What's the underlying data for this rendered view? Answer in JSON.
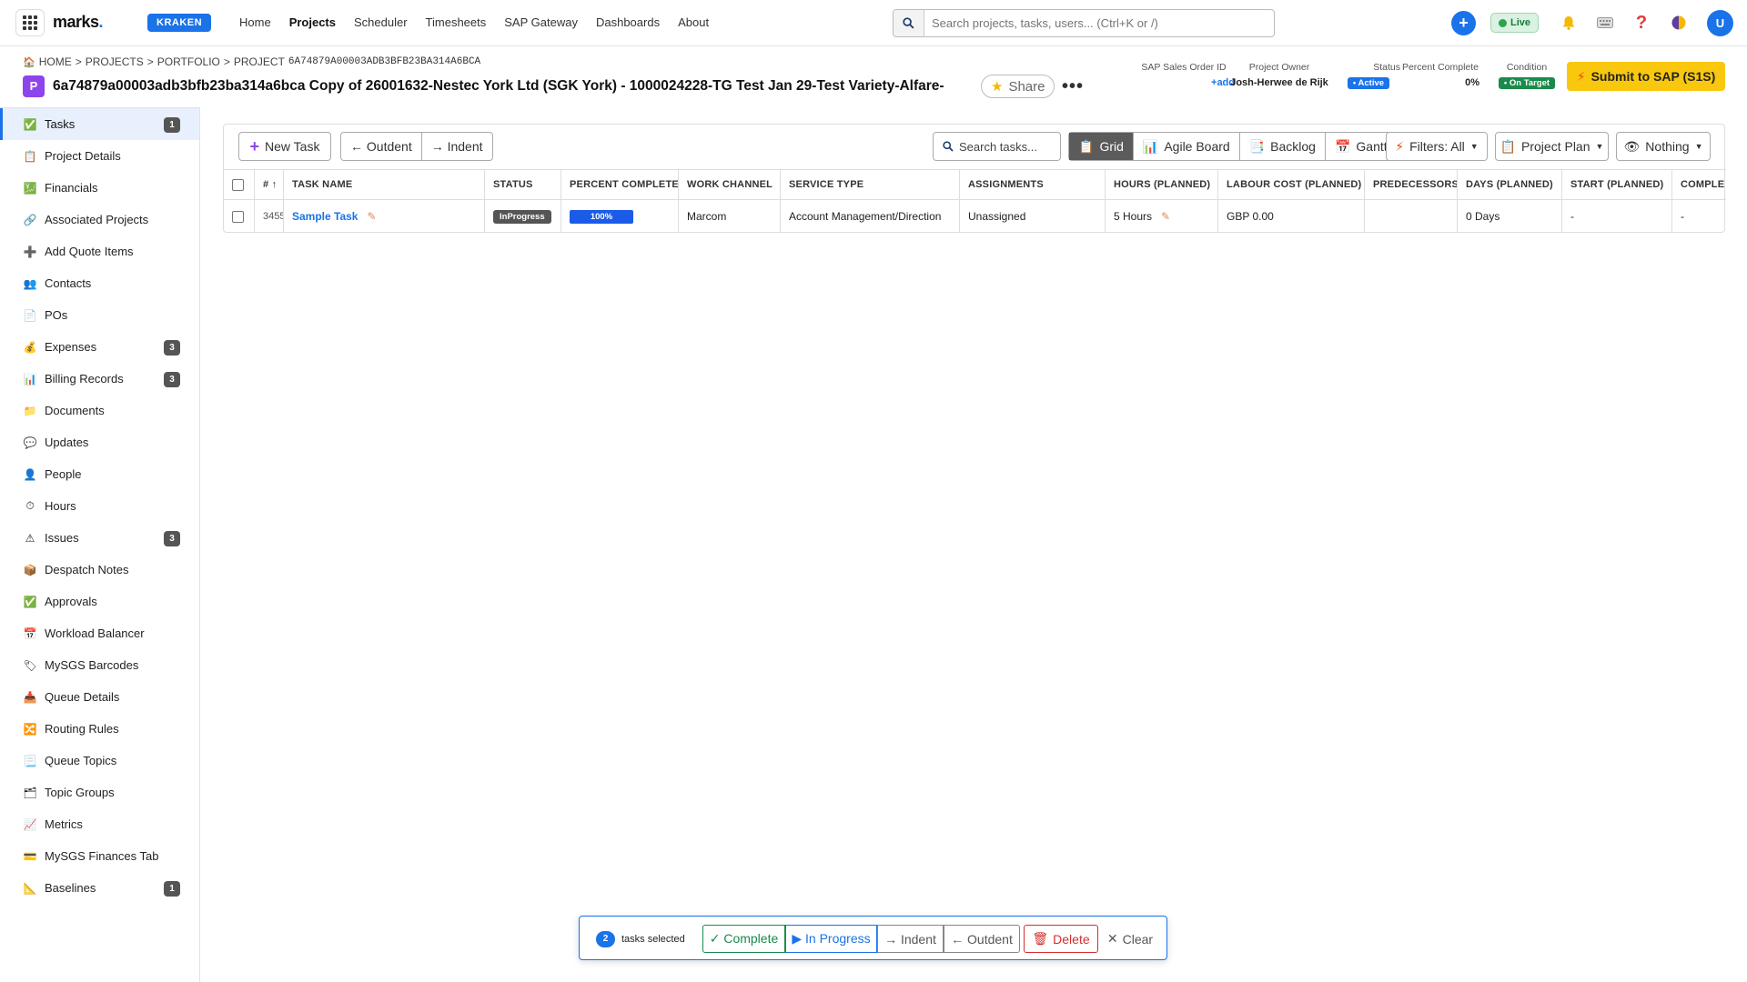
{
  "app": {
    "brand": "marks",
    "brand_dot": ".",
    "env_badge": "KRAKEN",
    "nav": [
      "Home",
      "Projects",
      "Scheduler",
      "Timesheets",
      "SAP Gateway",
      "Dashboards",
      "About"
    ],
    "active_nav": "Projects",
    "search_placeholder": "Search projects, tasks, users... (Ctrl+K or /)",
    "live_label": "Live",
    "user_initial": "U",
    "icons": [
      "apps-grid-icon",
      "search-icon",
      "plus-icon",
      "bell-icon",
      "keyboard-icon",
      "help-icon",
      "theme-icon"
    ]
  },
  "breadcrumb": {
    "home": "HOME",
    "sep": ">",
    "projects": "PROJECTS",
    "portfolio": "PORTFOLIO",
    "project": "PROJECT",
    "code": "6A74879A00003ADB3BFB23BA314A6BCA"
  },
  "project": {
    "badge": "P",
    "title": "6a74879a00003adb3bfb23ba314a6bca Copy of 26001632-Nestec York Ltd (SGK York) - 1000024228-TG Test Jan 29-Test Variety-Alfare-",
    "share_label": "Share",
    "more_label": "•••",
    "sap_order_label": "SAP Sales Order ID",
    "sap_order_value": "+add",
    "owner_label": "Project Owner",
    "owner_value": "Josh-Herwee de Rijk",
    "status_label": "Status",
    "status_value": "• Active",
    "pct_label": "Percent Complete",
    "pct_value": "0%",
    "condition_label": "Condition",
    "condition_value": "• On Target",
    "submit_label": "Submit to SAP (S1S)",
    "colors": {
      "badge": "#8e44ec",
      "active": "#1a73e8",
      "on_target": "#1b8a4a",
      "submit": "#f9c80e"
    }
  },
  "sidebar": {
    "items": [
      {
        "label": "Tasks",
        "icon": "✅",
        "icon_name": "tasks-icon",
        "count": "1",
        "active": true
      },
      {
        "label": "Project Details",
        "icon": "📋",
        "icon_name": "clipboard-icon",
        "count": ""
      },
      {
        "label": "Financials",
        "icon": "💹",
        "icon_name": "financials-icon",
        "count": ""
      },
      {
        "label": "Associated Projects",
        "icon": "🔗",
        "icon_name": "link-icon",
        "count": ""
      },
      {
        "label": "Add Quote Items",
        "icon": "➕",
        "icon_name": "plus-icon",
        "count": ""
      },
      {
        "label": "Contacts",
        "icon": "👥",
        "icon_name": "contacts-icon",
        "count": ""
      },
      {
        "label": "POs",
        "icon": "📄",
        "icon_name": "document-icon",
        "count": ""
      },
      {
        "label": "Expenses",
        "icon": "💰",
        "icon_name": "money-bag-icon",
        "count": "3"
      },
      {
        "label": "Billing Records",
        "icon": "📊",
        "icon_name": "bar-chart-icon",
        "count": "3"
      },
      {
        "label": "Documents",
        "icon": "📁",
        "icon_name": "folder-icon",
        "count": ""
      },
      {
        "label": "Updates",
        "icon": "💬",
        "icon_name": "speech-icon",
        "count": ""
      },
      {
        "label": "People",
        "icon": "👤",
        "icon_name": "person-icon",
        "count": ""
      },
      {
        "label": "Hours",
        "icon": "⏱",
        "icon_name": "stopwatch-icon",
        "count": ""
      },
      {
        "label": "Issues",
        "icon": "⚠",
        "icon_name": "warning-icon",
        "count": "3"
      },
      {
        "label": "Despatch Notes",
        "icon": "📦",
        "icon_name": "package-icon",
        "count": ""
      },
      {
        "label": "Approvals",
        "icon": "✅",
        "icon_name": "check-icon",
        "count": ""
      },
      {
        "label": "Workload Balancer",
        "icon": "📅",
        "icon_name": "calendar-icon",
        "count": ""
      },
      {
        "label": "MySGS Barcodes",
        "icon": "🏷",
        "icon_name": "tag-icon",
        "count": ""
      },
      {
        "label": "Queue Details",
        "icon": "📥",
        "icon_name": "inbox-icon",
        "count": ""
      },
      {
        "label": "Routing Rules",
        "icon": "🔀",
        "icon_name": "routing-icon",
        "count": ""
      },
      {
        "label": "Queue Topics",
        "icon": "📃",
        "icon_name": "page-icon",
        "count": ""
      },
      {
        "label": "Topic Groups",
        "icon": "🗂",
        "icon_name": "card-index-icon",
        "count": ""
      },
      {
        "label": "Metrics",
        "icon": "📈",
        "icon_name": "line-chart-icon",
        "count": ""
      },
      {
        "label": "MySGS Finances Tab",
        "icon": "💳",
        "icon_name": "card-icon",
        "count": ""
      },
      {
        "label": "Baselines",
        "icon": "📐",
        "icon_name": "ruler-icon",
        "count": "1"
      }
    ]
  },
  "toolbar": {
    "new_task": "New Task",
    "outdent": "← Outdent",
    "indent": "→ Indent",
    "search_placeholder": "Search tasks...",
    "views": [
      "Grid",
      "Agile Board",
      "Backlog",
      "Gantt"
    ],
    "active_view": "Grid",
    "filters": "Filters: All",
    "project_plan": "Project Plan",
    "nothing": "Nothing"
  },
  "table": {
    "columns": [
      "# ↑",
      "TASK NAME",
      "STATUS",
      "PERCENT COMPLETE",
      "WORK CHANNEL",
      "SERVICE TYPE",
      "ASSIGNMENTS",
      "HOURS (PLANNED)",
      "LABOUR COST (PLANNED)",
      "PREDECESSORS",
      "DAYS (PLANNED)",
      "START (PLANNED)",
      "COMPLE"
    ],
    "rows": [
      {
        "id": "3455",
        "name": "Sample Task",
        "status": "InProgress",
        "percent": "100%",
        "percent_value": 1.0,
        "channel": "Marcom",
        "service": "Account Management/Direction",
        "assignments": "Unassigned",
        "hours": "5 Hours",
        "cost": "GBP 0.00",
        "predecessors": "",
        "days": "0 Days",
        "start": "-",
        "complete": "-"
      }
    ]
  },
  "bulk": {
    "count": "2",
    "label": "tasks selected",
    "complete": "✓ Complete",
    "in_progress": "▶ In Progress",
    "indent": "→ Indent",
    "outdent": "← Outdent",
    "delete": "Delete",
    "clear": "Clear"
  }
}
